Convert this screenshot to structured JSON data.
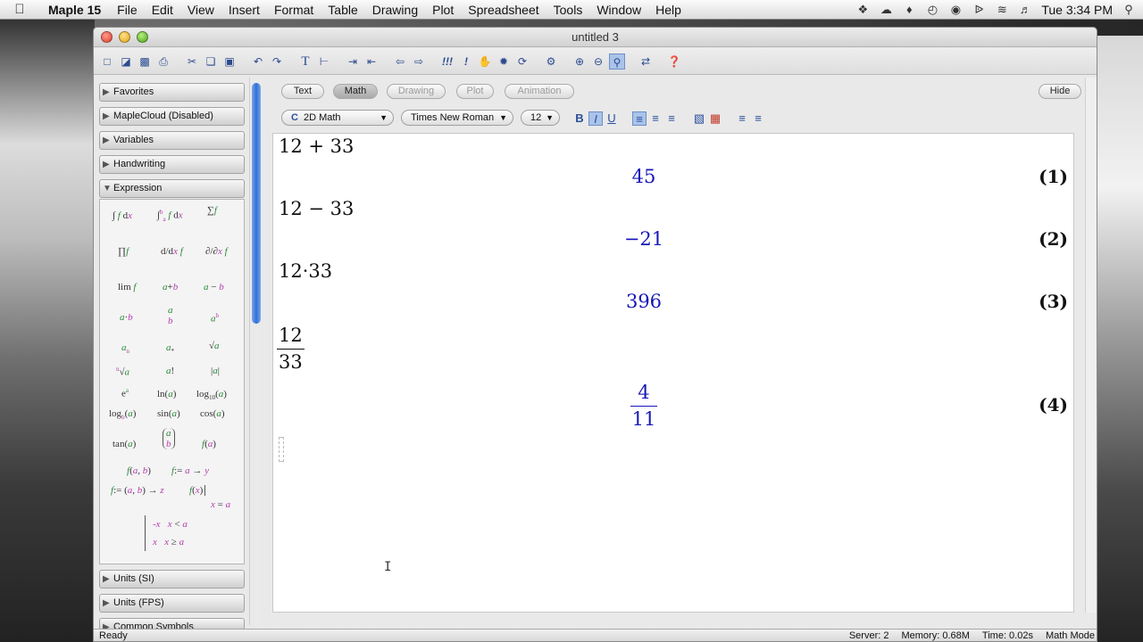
{
  "menubar": {
    "app": "Maple 15",
    "items": [
      "File",
      "Edit",
      "View",
      "Insert",
      "Format",
      "Table",
      "Drawing",
      "Plot",
      "Spreadsheet",
      "Tools",
      "Window",
      "Help"
    ],
    "clock": "Tue 3:34 PM"
  },
  "window": {
    "title": "untitled 3"
  },
  "palette": {
    "collapsed_top": [
      "Favorites",
      "MapleCloud (Disabled)",
      "Variables",
      "Handwriting"
    ],
    "expanded": "Expression",
    "collapsed_bottom": [
      "Units (SI)",
      "Units (FPS)",
      "Common Symbols"
    ]
  },
  "modes": {
    "text": "Text",
    "math": "Math",
    "drawing": "Drawing",
    "plot": "Plot",
    "animation": "Animation",
    "hide": "Hide"
  },
  "format": {
    "style": "2D Math",
    "font": "Times New Roman",
    "size": "12",
    "style_prefix": "C"
  },
  "document": {
    "rows": [
      {
        "input": "12 + 33",
        "output": "45",
        "label": "(1)"
      },
      {
        "input": "12 − 33",
        "output": "−21",
        "label": "(2)"
      },
      {
        "input": "12·33",
        "output": "396",
        "label": "(3)"
      },
      {
        "input_num": "12",
        "input_den": "33",
        "output_num": "4",
        "output_den": "11",
        "label": "(4)"
      }
    ]
  },
  "status": {
    "left": "Ready",
    "server": "Server: 2",
    "memory": "Memory: 0.68M",
    "time": "Time: 0.02s",
    "mode": "Math Mode"
  },
  "colors": {
    "output": "#1717b8",
    "palette_green": "#2a8a3a",
    "palette_magenta": "#b43fb0"
  }
}
